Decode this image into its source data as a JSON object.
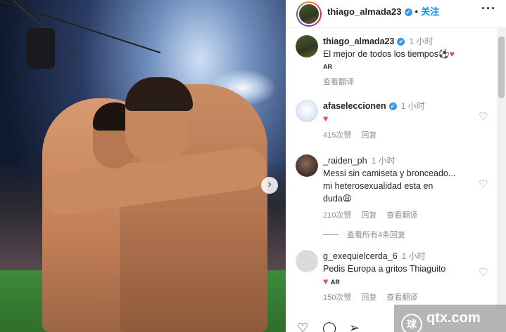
{
  "header": {
    "username": "thiago_almada23",
    "verified_mark": "✔",
    "separator": "•",
    "follow_label": "关注",
    "more_label": "···"
  },
  "caption": {
    "username": "thiago_almada23",
    "time": "1 小时",
    "text": "El mejor de todos los tiempos⚽",
    "heart": "♥",
    "ar": "AR",
    "translate_label": "查看翻译"
  },
  "comments": [
    {
      "username": "afaseleccionen",
      "time": "1 小时",
      "text": "♥",
      "likes": "415次赞",
      "reply_label": "回复"
    },
    {
      "username": "_raiden_ph",
      "time": "1 小时",
      "text_line1": "Messi sin camiseta y bronceado...",
      "text_line2": "mi heterosexualidad esta en",
      "text_line3": "duda😩",
      "likes": "210次赞",
      "reply_label": "回复",
      "translate_label": "查看翻译",
      "view_replies_label": "查看所有4条回复"
    },
    {
      "username": "g_exequielcerda_6",
      "time": "1 小时",
      "text": "Pedis Europa a gritos Thiaguito",
      "heart": "♥",
      "ar": "AR",
      "likes": "150次赞",
      "reply_label": "回复",
      "translate_label": "查看翻译"
    }
  ],
  "photo": {
    "next_label": "›"
  },
  "actions": {
    "like_icon": "♡",
    "comment_icon": "◯",
    "share_icon": "➢"
  },
  "watermark": {
    "logo_text": "球",
    "text": "qtx.com"
  },
  "colors": {
    "follow": "#0095f6",
    "verified": "#3897f0",
    "heart": "#ed4956",
    "muted": "#8e8e8e"
  }
}
